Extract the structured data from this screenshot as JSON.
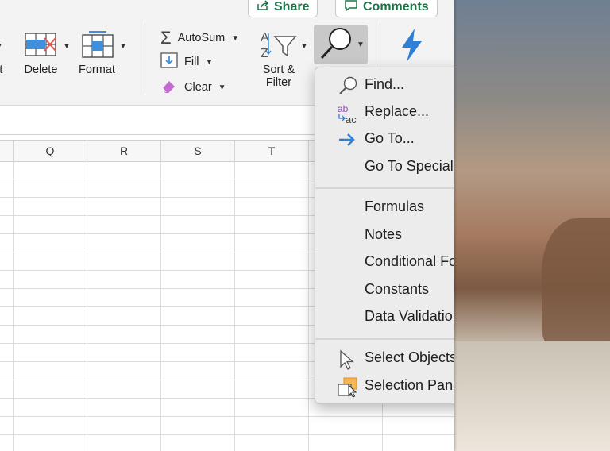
{
  "header": {
    "share_label": "Share",
    "comments_label": "Comments"
  },
  "ribbon": {
    "insert_partial_label": "rt",
    "delete_label": "Delete",
    "format_label": "Format",
    "autosum_label": "AutoSum",
    "fill_label": "Fill",
    "clear_label": "Clear",
    "sort_filter_line1": "Sort &",
    "sort_filter_line2": "Filter"
  },
  "sheet": {
    "columns": [
      "Q",
      "R",
      "S",
      "T"
    ]
  },
  "find_menu": {
    "items": [
      {
        "label": "Find...",
        "icon": "magnifier-icon"
      },
      {
        "label": "Replace...",
        "icon": "replace-icon"
      },
      {
        "label": "Go To...",
        "icon": "arrow-right-icon"
      },
      {
        "label": "Go To Special...",
        "icon": ""
      },
      {
        "label": "Formulas",
        "icon": ""
      },
      {
        "label": "Notes",
        "icon": ""
      },
      {
        "label": "Conditional Formatting",
        "icon": ""
      },
      {
        "label": "Constants",
        "icon": ""
      },
      {
        "label": "Data Validation",
        "icon": ""
      },
      {
        "label": "Select Objects",
        "icon": "pointer-icon"
      },
      {
        "label": "Selection Pane...",
        "icon": "selection-pane-icon"
      }
    ]
  },
  "colors": {
    "accent_green": "#1d7347",
    "menu_bg": "#ececec",
    "ideas_blue": "#2f7fd8"
  }
}
